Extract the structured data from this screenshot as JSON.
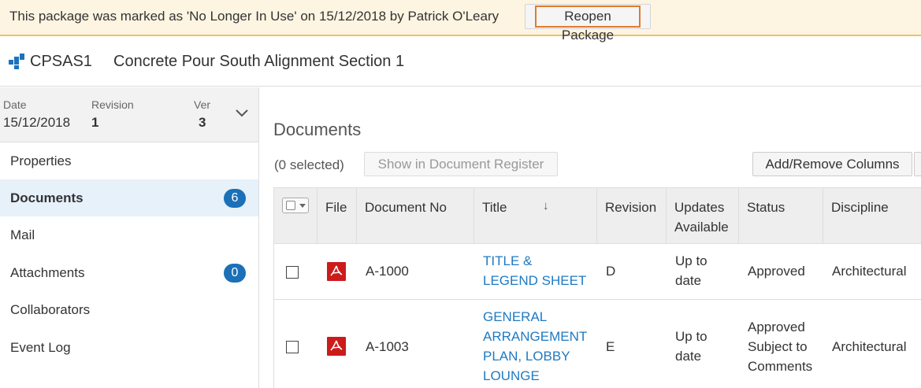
{
  "banner": {
    "message": "This package was marked as 'No Longer In Use' on 15/12/2018 by Patrick O'Leary",
    "reopen_label": "Reopen Package"
  },
  "header": {
    "code": "CPSAS1",
    "name": "Concrete Pour South Alignment Section 1",
    "icon": "package-icon"
  },
  "meta": {
    "date_label": "Date",
    "date_value": "15/12/2018",
    "revision_label": "Revision",
    "revision_value": "1",
    "ver_label": "Ver",
    "ver_value": "3"
  },
  "sidebar": {
    "items": [
      {
        "label": "Properties"
      },
      {
        "label": "Documents",
        "badge": "6"
      },
      {
        "label": "Mail"
      },
      {
        "label": "Attachments",
        "badge": "0"
      },
      {
        "label": "Collaborators"
      },
      {
        "label": "Event Log"
      }
    ]
  },
  "main": {
    "title": "Documents",
    "selected_count": "(0 selected)",
    "show_register_label": "Show in Document Register",
    "add_columns_label": "Add/Remove Columns"
  },
  "table": {
    "columns": {
      "file": "File",
      "doc_no": "Document No",
      "title": "Title",
      "revision": "Revision",
      "updates_1": "Updates",
      "updates_2": "Available",
      "status": "Status",
      "discipline": "Discipline"
    },
    "rows": [
      {
        "doc_no": "A-1000",
        "title_lines": [
          "TITLE &",
          "LEGEND SHEET"
        ],
        "revision": "D",
        "updates_lines": [
          "Up to",
          "date"
        ],
        "status_lines": [
          "Approved"
        ],
        "discipline": "Architectural"
      },
      {
        "doc_no": "A-1003",
        "title_lines": [
          "GENERAL",
          "ARRANGEMENT",
          "PLAN, LOBBY",
          "LOUNGE"
        ],
        "revision": "E",
        "updates_lines": [
          "Up to",
          "date"
        ],
        "status_lines": [
          "Approved",
          "Subject to",
          "Comments"
        ],
        "discipline": "Architectural"
      }
    ]
  },
  "colors": {
    "banner_bg": "#fdf5e2",
    "accent_blue": "#1b70b8",
    "link_blue": "#1f7ac2",
    "pdf_red": "#cc1b1b",
    "focus_orange": "#e07b30"
  }
}
